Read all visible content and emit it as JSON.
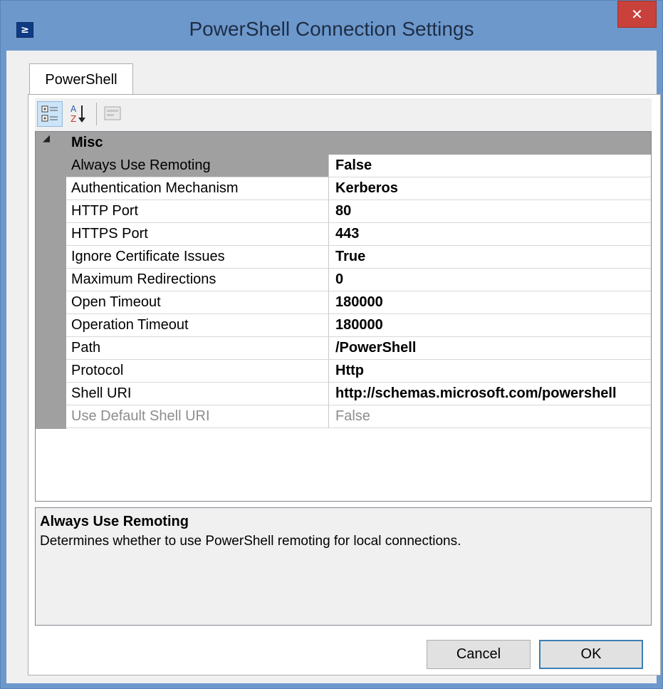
{
  "window": {
    "title": "PowerShell Connection Settings",
    "app_icon": "powershell-icon",
    "close_label": "✕"
  },
  "tabs": [
    {
      "label": "PowerShell"
    }
  ],
  "toolbar": {
    "icons": [
      "categorized-view-icon",
      "alphabetical-sort-icon",
      "property-pages-icon"
    ]
  },
  "grid": {
    "category": {
      "label": "Misc",
      "toggle": "◢"
    },
    "properties": [
      {
        "name": "Always Use Remoting",
        "value": "False"
      },
      {
        "name": "Authentication Mechanism",
        "value": "Kerberos"
      },
      {
        "name": "HTTP Port",
        "value": "80"
      },
      {
        "name": "HTTPS Port",
        "value": "443"
      },
      {
        "name": "Ignore Certificate Issues",
        "value": "True"
      },
      {
        "name": "Maximum Redirections",
        "value": "0"
      },
      {
        "name": "Open Timeout",
        "value": "180000"
      },
      {
        "name": "Operation Timeout",
        "value": "180000"
      },
      {
        "name": "Path",
        "value": "/PowerShell"
      },
      {
        "name": "Protocol",
        "value": "Http"
      },
      {
        "name": "Shell URI",
        "value": "http://schemas.microsoft.com/powershell"
      },
      {
        "name": "Use Default Shell URI",
        "value": "False"
      }
    ],
    "selected": "Always Use Remoting"
  },
  "help": {
    "title": "Always Use Remoting",
    "description": "Determines whether to use PowerShell remoting for local connections."
  },
  "buttons": {
    "cancel": "Cancel",
    "ok": "OK"
  },
  "colors": {
    "title_bar": "#6d98cc",
    "close_button": "#c8413a",
    "category_band": "#a0a0a0"
  }
}
